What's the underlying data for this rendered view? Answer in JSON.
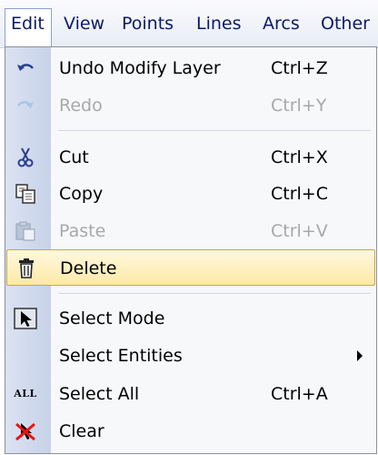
{
  "menubar": {
    "items": [
      "Edit",
      "View",
      "Points",
      "Lines",
      "Arcs",
      "Other"
    ]
  },
  "menu": {
    "undo": {
      "label": "Undo Modify Layer",
      "shortcut": "Ctrl+Z"
    },
    "redo": {
      "label": "Redo",
      "shortcut": "Ctrl+Y"
    },
    "cut": {
      "label": "Cut",
      "shortcut": "Ctrl+X"
    },
    "copy": {
      "label": "Copy",
      "shortcut": "Ctrl+C"
    },
    "paste": {
      "label": "Paste",
      "shortcut": "Ctrl+V"
    },
    "delete": {
      "label": "Delete"
    },
    "select_mode": {
      "label": "Select Mode"
    },
    "select_entities": {
      "label": "Select Entities"
    },
    "select_all": {
      "label": "Select All",
      "shortcut": "Ctrl+A",
      "icon_text": "ALL"
    },
    "clear": {
      "label": "Clear"
    }
  },
  "colors": {
    "highlight": "#fde9a7",
    "menubar_text": "#0b1a66",
    "disabled_text": "#a8a8a8"
  }
}
